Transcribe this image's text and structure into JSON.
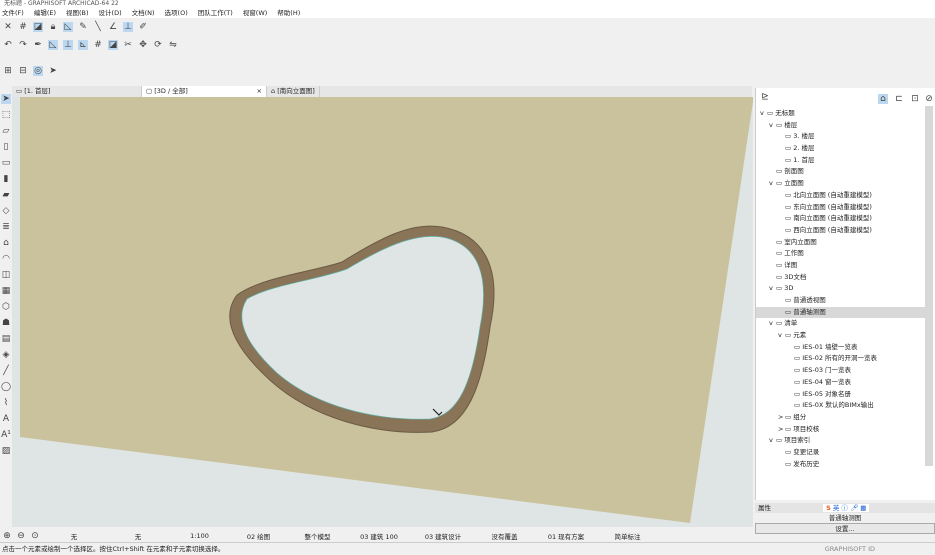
{
  "window": {
    "title": "无标题 - GRAPHISOFT ARCHICAD-64 22"
  },
  "menu": [
    "文件(F)",
    "编辑(E)",
    "视图(B)",
    "设计(D)",
    "文档(N)",
    "选项(O)",
    "团队工作(T)",
    "视窗(W)",
    "帮助(H)"
  ],
  "tabs": [
    {
      "label": "[1. 首层]",
      "icon": "floor-plan-icon"
    },
    {
      "label": "[3D / 全部]",
      "icon": "3d-icon",
      "active": true
    },
    {
      "label": "[南向立面图]",
      "icon": "elevation-icon"
    }
  ],
  "tab_close": "×",
  "navigator": {
    "items": [
      {
        "label": "无标题",
        "level": 0,
        "expand": "v"
      },
      {
        "label": "楼层",
        "level": 1,
        "expand": "v"
      },
      {
        "label": "3. 楼层",
        "level": 2
      },
      {
        "label": "2. 楼层",
        "level": 2
      },
      {
        "label": "1. 首层",
        "level": 2
      },
      {
        "label": "剖面图",
        "level": 1
      },
      {
        "label": "立面图",
        "level": 1,
        "expand": "v"
      },
      {
        "label": "北向立面图 (自动重建模型)",
        "level": 2
      },
      {
        "label": "东向立面图 (自动重建模型)",
        "level": 2
      },
      {
        "label": "南向立面图 (自动重建模型)",
        "level": 2
      },
      {
        "label": "西向立面图 (自动重建模型)",
        "level": 2
      },
      {
        "label": "室内立面图",
        "level": 1
      },
      {
        "label": "工作图",
        "level": 1
      },
      {
        "label": "详图",
        "level": 1
      },
      {
        "label": "3D文档",
        "level": 1
      },
      {
        "label": "3D",
        "level": 1,
        "expand": "v"
      },
      {
        "label": "普通透视图",
        "level": 2
      },
      {
        "label": "普通轴测图",
        "level": 2,
        "selected": true
      },
      {
        "label": "清单",
        "level": 1,
        "expand": "v"
      },
      {
        "label": "元素",
        "level": 2,
        "expand": "v"
      },
      {
        "label": "IES-01 墙壁一览表",
        "level": 3
      },
      {
        "label": "IES-02 所有的开洞一览表",
        "level": 3
      },
      {
        "label": "IES-03 门一览表",
        "level": 3
      },
      {
        "label": "IES-04 窗一览表",
        "level": 3
      },
      {
        "label": "IES-05 对象名册",
        "level": 3
      },
      {
        "label": "IES-0X 默认的BIMx输出",
        "level": 3
      },
      {
        "label": "组分",
        "level": 2,
        "expand": ">"
      },
      {
        "label": "项目校核",
        "level": 2,
        "expand": ">"
      },
      {
        "label": "项目索引",
        "level": 1,
        "expand": "v"
      },
      {
        "label": "变更记录",
        "level": 2
      },
      {
        "label": "发布历史",
        "level": 2
      }
    ]
  },
  "properties": {
    "header": "属性",
    "value": "普通轴测图",
    "settings_button": "设置..."
  },
  "ime": {
    "label": "英"
  },
  "bottom_bar": {
    "none1": "无",
    "none2": "无",
    "scale": "1:100",
    "layer": "02 绘图",
    "model": "整个模型",
    "pen": "03 建筑 100",
    "mvo": "03 建筑设计",
    "override": "没有覆盖",
    "reno": "01 现有方案",
    "dim": "简单标注",
    "settings": "设置..."
  },
  "status": {
    "message": "点击一个元素或绘制一个选择区。按住Ctrl+Shift 在元素和子元素切换选择。",
    "brand": "GRAPHISOFT ID"
  },
  "colors": {
    "wall": "#c9c29c",
    "rim": "#8a7458",
    "glass": "#dfe5e4",
    "ground": "#dfe5e4",
    "selected": "#bcd8f0"
  }
}
